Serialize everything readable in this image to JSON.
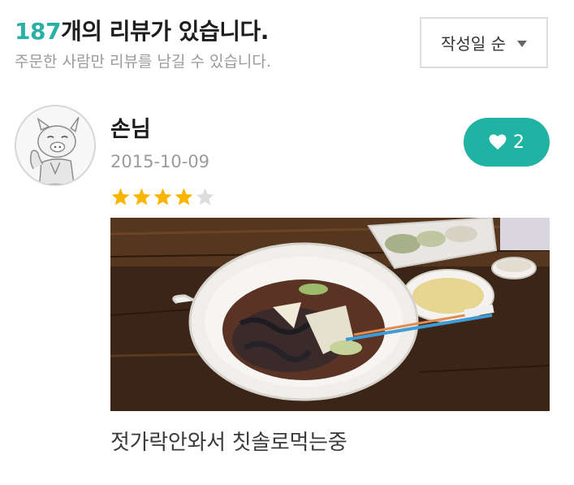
{
  "header": {
    "count": "187",
    "title_suffix": "개의 리뷰가 있습니다.",
    "subtitle": "주문한 사람만 리뷰를 남길 수 있습니다."
  },
  "sort": {
    "label": "작성일 순",
    "icon": "caret-down-icon"
  },
  "review": {
    "author": "손님",
    "date": "2015-10-09",
    "avatar_icon": "pig-avatar-icon",
    "rating": 4,
    "rating_max": 5,
    "star_filled_color": "#f7b500",
    "star_empty_color": "#dcdcdc",
    "likes": "2",
    "like_icon": "heart-icon",
    "like_color": "#20b2a3",
    "photo": "food-photo",
    "text": "젓가락안와서 칫솔로먹는중"
  },
  "colors": {
    "accent": "#2bb0a6",
    "muted": "#9a9a9a"
  }
}
